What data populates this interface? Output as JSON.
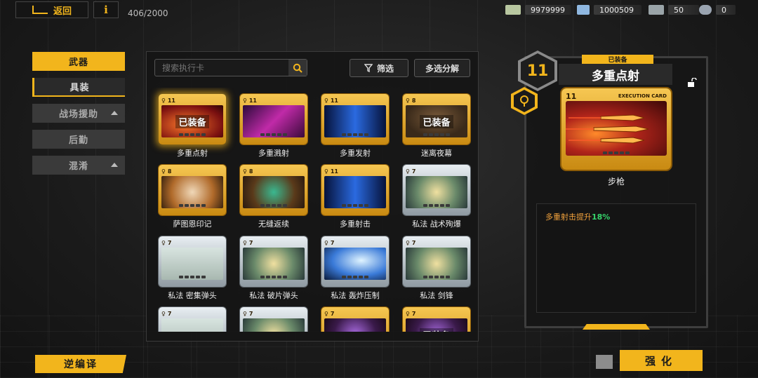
{
  "topbar": {
    "back_label": "返回",
    "info_label": "i",
    "card_count": "406/2000"
  },
  "resources": [
    {
      "icon": "cash-icon",
      "value": "9979999",
      "color": "#b8c7a0"
    },
    {
      "icon": "crystal-icon",
      "value": "1000509",
      "color": "#8fb7e0"
    },
    {
      "icon": "ticket-icon",
      "value": "50",
      "color": "#9aa4a8"
    },
    {
      "icon": "chip-icon",
      "value": "0",
      "color": "#9aa4b0"
    }
  ],
  "nav": {
    "weapons": "武器",
    "gear": "具装",
    "battlefield_support": "战场援助",
    "logistics": "后勤",
    "mixed": "混淆"
  },
  "search": {
    "placeholder": "搜索执行卡"
  },
  "filter_label": "筛选",
  "multi_decompose_label": "多选分解",
  "cards": [
    {
      "name": "多重点射",
      "level": "11",
      "frame": "gold",
      "equipped": true,
      "selected": true,
      "art": "red"
    },
    {
      "name": "多重溅射",
      "level": "11",
      "frame": "gold",
      "equipped": false,
      "art": "pink"
    },
    {
      "name": "多重发射",
      "level": "11",
      "frame": "gold",
      "equipped": false,
      "art": "blue"
    },
    {
      "name": "迷离夜幕",
      "level": "8",
      "frame": "gold",
      "equipped": true,
      "art": "brown"
    },
    {
      "name": "萨图恩印记",
      "level": "8",
      "frame": "gold",
      "equipped": false,
      "art": "orange"
    },
    {
      "name": "无缝返续",
      "level": "8",
      "frame": "gold",
      "equipped": false,
      "art": "teal"
    },
    {
      "name": "多重射击",
      "level": "11",
      "frame": "gold",
      "equipped": false,
      "art": "blue"
    },
    {
      "name": "私法 战术殉爆",
      "level": "7",
      "frame": "silver",
      "equipped": false,
      "art": "green"
    },
    {
      "name": "私法 密集弹头",
      "level": "7",
      "frame": "silver",
      "equipped": false,
      "art": "white"
    },
    {
      "name": "私法 破片弹头",
      "level": "7",
      "frame": "silver",
      "equipped": false,
      "art": "green"
    },
    {
      "name": "私法 轰炸压制",
      "level": "7",
      "frame": "silver",
      "equipped": false,
      "art": "lightblue"
    },
    {
      "name": "私法 剑锋",
      "level": "7",
      "frame": "silver",
      "equipped": false,
      "art": "green"
    },
    {
      "name": "",
      "level": "7",
      "frame": "silver",
      "equipped": false,
      "art": "white"
    },
    {
      "name": "",
      "level": "7",
      "frame": "silver",
      "equipped": false,
      "art": "green"
    },
    {
      "name": "",
      "level": "7",
      "frame": "gold",
      "equipped": false,
      "art": "purple"
    },
    {
      "name": "",
      "level": "7",
      "frame": "gold",
      "equipped": true,
      "art": "purple"
    }
  ],
  "equipped_tag": "已装备",
  "card_header_text": "EXECUTION CARD",
  "detail": {
    "status": "已装备",
    "level": "11",
    "title": "多重点射",
    "weapon_type": "步枪",
    "desc_text": "多重射击提升",
    "desc_value": "18%"
  },
  "decompile_label": "逆编译",
  "enhance_label": "强化",
  "colors": {
    "accent": "#f2b51c",
    "bonus": "#36d36b",
    "desc": "#f2a23c"
  }
}
